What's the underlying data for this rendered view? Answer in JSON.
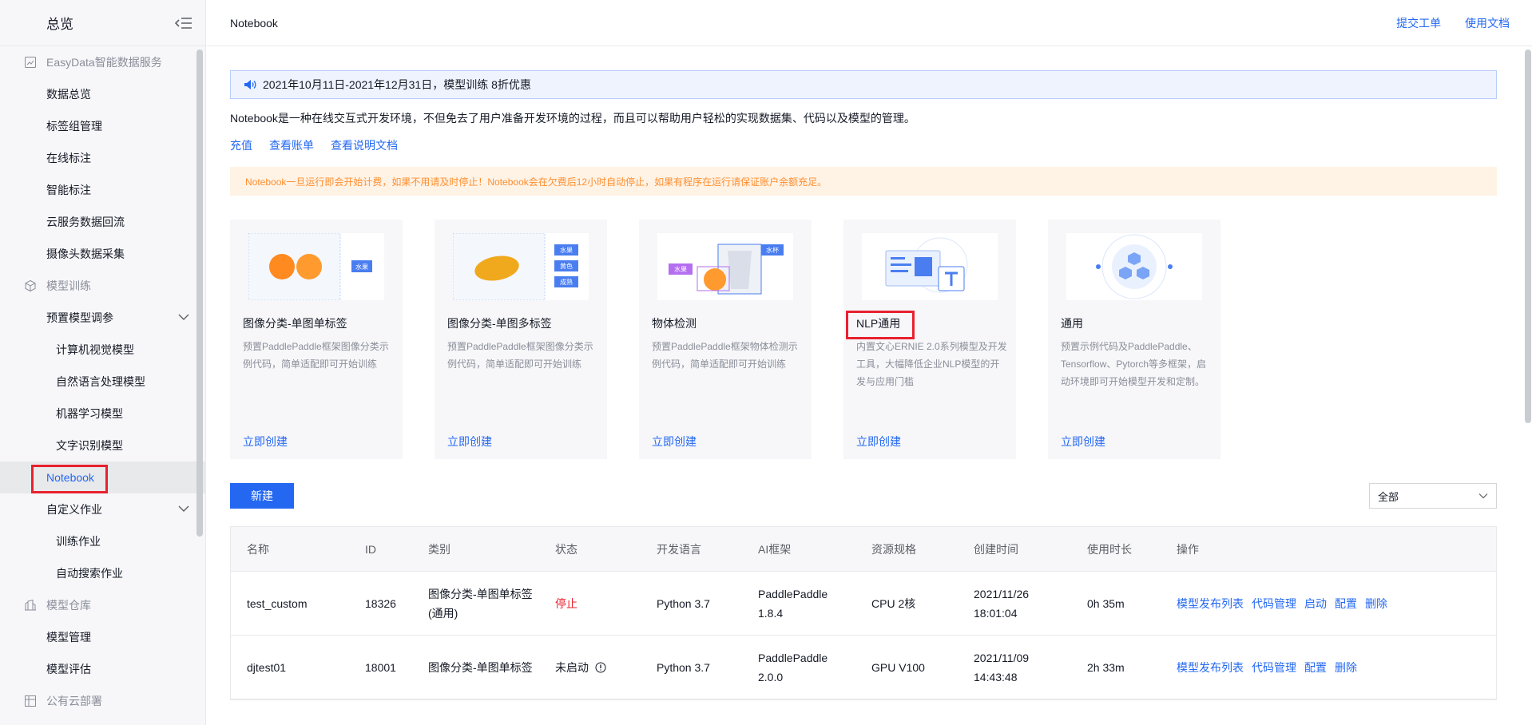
{
  "sidebar": {
    "title": "总览",
    "groups": [
      {
        "label": "EasyData智能数据服务",
        "items": [
          "数据总览",
          "标签组管理",
          "在线标注",
          "智能标注",
          "云服务数据回流",
          "摄像头数据采集"
        ]
      },
      {
        "label": "模型训练"
      },
      {
        "label": "模型仓库",
        "items": [
          "模型管理",
          "模型评估"
        ]
      },
      {
        "label": "公有云部署"
      }
    ],
    "preset_tuning": {
      "label": "预置模型调参",
      "children": [
        "计算机视觉模型",
        "自然语言处理模型",
        "机器学习模型",
        "文字识别模型"
      ]
    },
    "notebook": "Notebook",
    "custom_job": {
      "label": "自定义作业",
      "children": [
        "训练作业",
        "自动搜索作业"
      ]
    }
  },
  "topbar": {
    "title": "Notebook",
    "submit_ticket": "提交工单",
    "docs": "使用文档"
  },
  "notice": "2021年10月11日-2021年12月31日，模型训练 8折优惠",
  "description": "Notebook是一种在线交互式开发环境，不但免去了用户准备开发环境的过程，而且可以帮助用户轻松的实现数据集、代码以及模型的管理。",
  "links": [
    "充值",
    "查看账单",
    "查看说明文档"
  ],
  "warning": "Notebook一旦运行即会开始计费，如果不用请及时停止！Notebook会在欠费后12小时自动停止，如果有程序在运行请保证账户余额充足。",
  "cards": [
    {
      "name": "图像分类-单图单标签",
      "desc": "预置PaddlePaddle框架图像分类示例代码，简单适配即可开始训练",
      "action": "立即创建",
      "tags": [
        "水果"
      ]
    },
    {
      "name": "图像分类-单图多标签",
      "desc": "预置PaddlePaddle框架图像分类示例代码，简单适配即可开始训练",
      "action": "立即创建",
      "tags": [
        "水果",
        "黄色",
        "成熟"
      ]
    },
    {
      "name": "物体检测",
      "desc": "预置PaddlePaddle框架物体检测示例代码，简单适配即可开始训练",
      "action": "立即创建",
      "tags": [
        "水果",
        "水杯"
      ]
    },
    {
      "name": "NLP通用",
      "desc": "内置文心ERNIE 2.0系列模型及开发工具，大幅降低企业NLP模型的开发与应用门槛",
      "action": "立即创建"
    },
    {
      "name": "通用",
      "desc": "预置示例代码及PaddlePaddle、Tensorflow、Pytorch等多框架，启动环境即可开始模型开发和定制。",
      "action": "立即创建"
    }
  ],
  "new_button": "新建",
  "filter": {
    "selected": "全部"
  },
  "table": {
    "headers": [
      "名称",
      "ID",
      "类别",
      "状态",
      "开发语言",
      "AI框架",
      "资源规格",
      "创建时间",
      "使用时长",
      "操作"
    ],
    "rows": [
      {
        "name": "test_custom",
        "id": "18326",
        "category": "图像分类-单图单标签(通用)",
        "status": "停止",
        "lang": "Python 3.7",
        "framework": "PaddlePaddle 1.8.4",
        "resource": "CPU 2核",
        "created": "2021/11/26 18:01:04",
        "duration": "0h 35m",
        "ops": [
          "模型发布列表",
          "代码管理",
          "启动",
          "配置",
          "删除"
        ]
      },
      {
        "name": "djtest01",
        "id": "18001",
        "category": "图像分类-单图单标签",
        "status": "未启动",
        "lang": "Python 3.7",
        "framework": "PaddlePaddle 2.0.0",
        "resource": "GPU V100",
        "created": "2021/11/09 14:43:48",
        "duration": "2h 33m",
        "ops": [
          "模型发布列表",
          "代码管理",
          "配置",
          "删除"
        ]
      }
    ]
  },
  "colors": {
    "accent": "#2468f2",
    "highlight": "#e8212e",
    "warning": "#ff8e2e"
  }
}
